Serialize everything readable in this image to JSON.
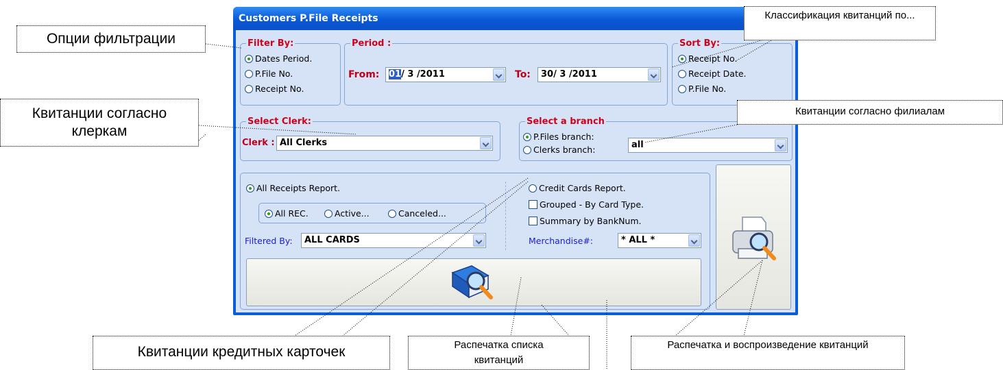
{
  "window": {
    "title": "Customers P.File Receipts",
    "filter_by": {
      "legend": "Filter By:",
      "options": [
        "Dates Period.",
        "P.File No.",
        "Receipt No."
      ],
      "selected": 0
    },
    "period": {
      "legend": "Period :",
      "from_label": "From:",
      "from_day": "01",
      "from_rest": "/ 3 /2011",
      "to_label": "To:",
      "to_value": "30/ 3 /2011"
    },
    "sort_by": {
      "legend": "Sort By:",
      "options": [
        "Receipt No.",
        "Receipt Date.",
        "P.File No."
      ],
      "selected": 0
    },
    "select_clerk": {
      "legend": "Select Clerk:",
      "clerk_label": "Clerk :",
      "clerk_value": "All Clerks"
    },
    "select_branch": {
      "legend": "Select a branch",
      "options": [
        "P.Files branch:",
        "Clerks branch:"
      ],
      "selected": 0,
      "value": "all"
    },
    "report": {
      "all_receipts": "All Receipts Report.",
      "rec_options": [
        "All REC.",
        "Active...",
        "Canceled..."
      ],
      "rec_selected": 0,
      "filtered_by_label": "Filtered By:",
      "filtered_by_value": "ALL CARDS",
      "credit_cards": "Credit Cards Report.",
      "grouped": "Grouped - By Card Type.",
      "summary": "Summary by BankNum.",
      "merchandise_label": "Merchandise#:",
      "merchandise_value": "* ALL *"
    }
  },
  "callouts": {
    "filter_options": "Опции фильтрации",
    "sort_classification": "Классификация квитанций по...",
    "by_clerks": "Квитанции согласно клеркам",
    "by_branches": "Квитанции согласно филиалам",
    "credit_cards": "Квитанции кредитных карточек",
    "print_list": "Распечатка списка квитанций",
    "print_play": "Распечатка и воспроизведение квитанций"
  }
}
